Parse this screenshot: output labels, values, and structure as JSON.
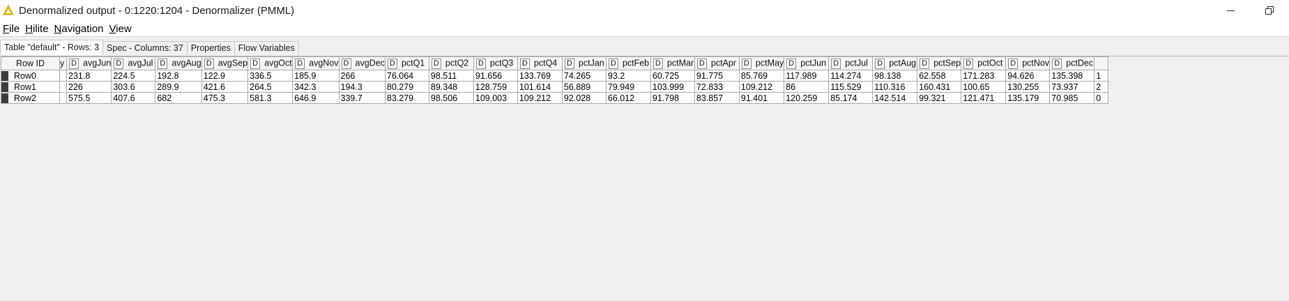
{
  "window": {
    "title": "Denormalized output - 0:1220:1204 - Denormalizer (PMML)"
  },
  "menu": [
    {
      "mnemonic": "F",
      "rest": "ile"
    },
    {
      "mnemonic": "H",
      "rest": "ilite"
    },
    {
      "mnemonic": "N",
      "rest": "avigation"
    },
    {
      "mnemonic": "V",
      "rest": "iew"
    }
  ],
  "tabs": [
    "Table \"default\" - Rows: 3",
    "Spec - Columns: 37",
    "Properties",
    "Flow Variables"
  ],
  "table": {
    "rowid_header": "Row ID",
    "partial_header": "y",
    "type_badge": "D",
    "columns": [
      "avgJun",
      "avgJul",
      "avgAug",
      "avgSep",
      "avgOct",
      "avgNov",
      "avgDec",
      "pctQ1",
      "pctQ2",
      "pctQ3",
      "pctQ4",
      "pctJan",
      "pctFeb",
      "pctMar",
      "pctApr",
      "pctMay",
      "pctJun",
      "pctJul",
      "pctAug",
      "pctSep",
      "pctOct",
      "pctNov",
      "pctDec"
    ],
    "rows": [
      {
        "id": "Row0",
        "values": [
          "231.8",
          "224.5",
          "192.8",
          "122.9",
          "336.5",
          "185.9",
          "266",
          "76.064",
          "98.511",
          "91.656",
          "133.769",
          "74.265",
          "93.2",
          "60.725",
          "91.775",
          "85.769",
          "117.989",
          "114.274",
          "98.138",
          "62.558",
          "171.283",
          "94.626",
          "135.398"
        ],
        "overflow": "1"
      },
      {
        "id": "Row1",
        "values": [
          "226",
          "303.6",
          "289.9",
          "421.6",
          "264.5",
          "342.3",
          "194.3",
          "80.279",
          "89.348",
          "128.759",
          "101.614",
          "56.889",
          "79.949",
          "103.999",
          "72.833",
          "109.212",
          "86",
          "115.529",
          "110.316",
          "160.431",
          "100.65",
          "130.255",
          "73.937"
        ],
        "overflow": "2"
      },
      {
        "id": "Row2",
        "values": [
          "575.5",
          "407.6",
          "682",
          "475.3",
          "581.3",
          "646.9",
          "339.7",
          "83.279",
          "98.506",
          "109.003",
          "109.212",
          "92.028",
          "66.012",
          "91.798",
          "83.857",
          "91.401",
          "120.259",
          "85.174",
          "142.514",
          "99.321",
          "121.471",
          "135.179",
          "70.985"
        ],
        "overflow": "0"
      }
    ]
  }
}
